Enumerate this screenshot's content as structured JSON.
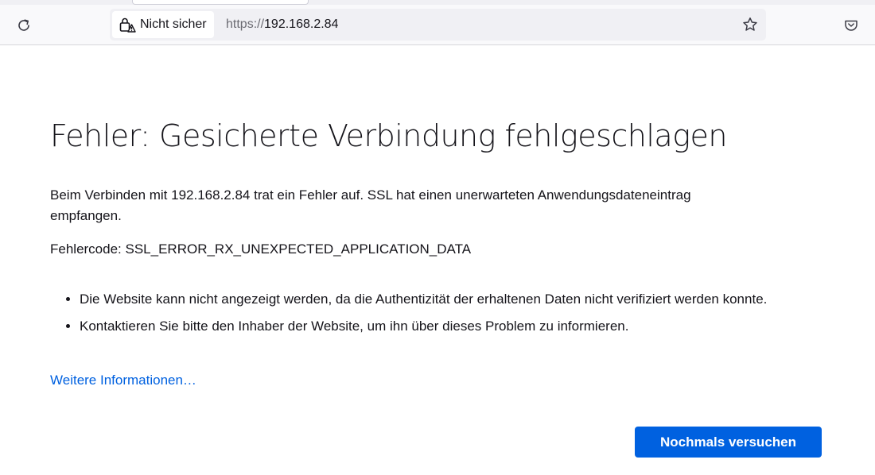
{
  "browser": {
    "identity": {
      "label": "Nicht sicher",
      "icon": "lock-warning-icon"
    },
    "url": {
      "scheme": "https://",
      "host": "192.168.2.84"
    },
    "icons": {
      "reload": "reload-icon",
      "bookmark": "star-icon",
      "pocket": "pocket-icon"
    }
  },
  "error_page": {
    "title": "Fehler: Gesicherte Verbindung fehlgeschlagen",
    "short_desc": "Beim Verbinden mit 192.168.2.84 trat ein Fehler auf. SSL hat einen unerwarteten Anwendungsdateneintrag empfangen.",
    "error_code": "Fehlercode: SSL_ERROR_RX_UNEXPECTED_APPLICATION_DATA",
    "advice": [
      "Die Website kann nicht angezeigt werden, da die Authentizität der erhaltenen Daten nicht verifiziert werden konnte.",
      "Kontaktieren Sie bitte den Inhaber der Website, um ihn über dieses Problem zu informieren."
    ],
    "learn_more": "Weitere Informationen…",
    "retry_button": "Nochmals versuchen"
  },
  "colors": {
    "accent": "#0061e0",
    "text": "#15141a",
    "toolbar_bg": "#f9f9fb",
    "urlbar_bg": "#f0f0f4"
  }
}
